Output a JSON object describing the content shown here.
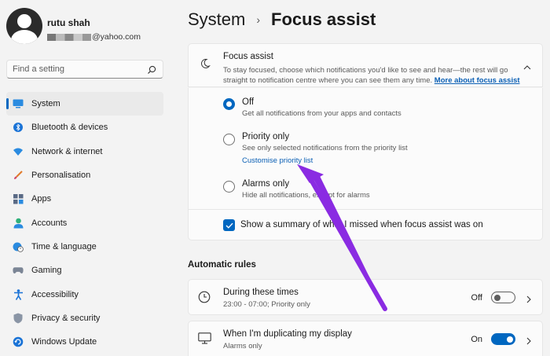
{
  "profile": {
    "name": "rutu shah",
    "email_suffix": "@yahoo.com"
  },
  "search": {
    "placeholder": "Find a setting"
  },
  "nav": [
    {
      "label": "System",
      "icon": "system-icon",
      "active": true
    },
    {
      "label": "Bluetooth & devices",
      "icon": "bluetooth-icon"
    },
    {
      "label": "Network & internet",
      "icon": "wifi-icon"
    },
    {
      "label": "Personalisation",
      "icon": "brush-icon"
    },
    {
      "label": "Apps",
      "icon": "apps-icon"
    },
    {
      "label": "Accounts",
      "icon": "accounts-icon"
    },
    {
      "label": "Time & language",
      "icon": "globe-clock-icon"
    },
    {
      "label": "Gaming",
      "icon": "gamepad-icon"
    },
    {
      "label": "Accessibility",
      "icon": "accessibility-icon"
    },
    {
      "label": "Privacy & security",
      "icon": "shield-icon"
    },
    {
      "label": "Windows Update",
      "icon": "update-icon"
    }
  ],
  "header": {
    "breadcrumb_parent": "System",
    "separator": "›",
    "title": "Focus assist"
  },
  "focus_assist": {
    "title": "Focus assist",
    "description": "To stay focused, choose which notifications you'd like to see and hear—the rest will go straight to notification centre where you can see them any time.",
    "more_link": "More about focus assist",
    "options": [
      {
        "title": "Off",
        "desc": "Get all notifications from your apps and contacts",
        "selected": true
      },
      {
        "title": "Priority only",
        "desc": "See only selected notifications from the priority list",
        "link": "Customise priority list",
        "selected": false
      },
      {
        "title": "Alarms only",
        "desc": "Hide all notifications, except for alarms",
        "selected": false
      }
    ],
    "summary_label": "Show a summary of what I missed when focus assist was on",
    "summary_checked": true
  },
  "automatic_rules": {
    "heading": "Automatic rules",
    "rules": [
      {
        "title": "During these times",
        "subtitle": "23:00 - 07:00; Priority only",
        "state": "Off",
        "on": false
      },
      {
        "title": "When I'm duplicating my display",
        "subtitle": "Alarms only",
        "state": "On",
        "on": true
      }
    ]
  },
  "colors": {
    "accent": "#0067c0",
    "annotation_arrow": "#8a2be2"
  }
}
